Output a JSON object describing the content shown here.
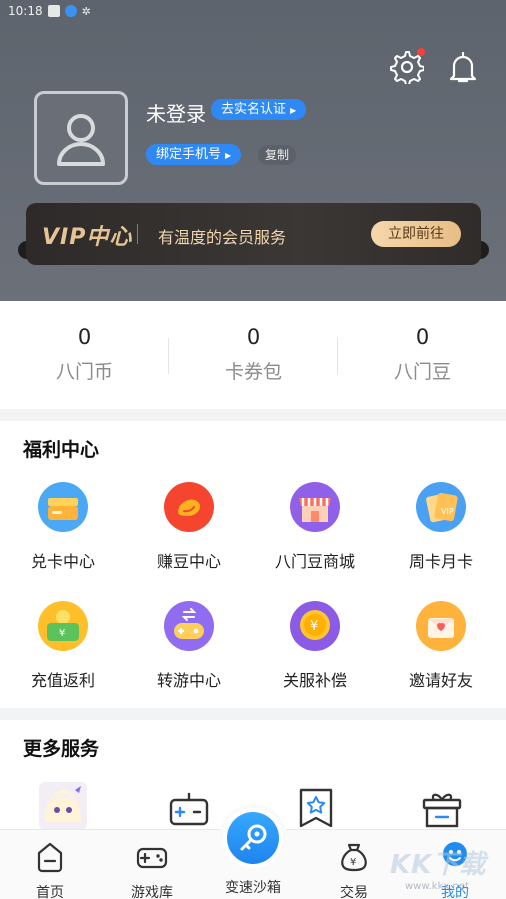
{
  "status_bar": {
    "time": "10:18"
  },
  "header": {
    "username": "未登录",
    "verify_label": "去实名认证",
    "bind_phone_label": "绑定手机号",
    "copy_label": "复制"
  },
  "vip": {
    "title": "VIP中心",
    "desc": "有温度的会员服务",
    "button": "立即前往"
  },
  "stats": [
    {
      "value": "0",
      "label": "八门币"
    },
    {
      "value": "0",
      "label": "卡券包"
    },
    {
      "value": "0",
      "label": "八门豆"
    }
  ],
  "welfare": {
    "title": "福利中心",
    "items": [
      {
        "label": "兑卡中心",
        "icon": "card-exchange-icon"
      },
      {
        "label": "赚豆中心",
        "icon": "earn-beans-icon"
      },
      {
        "label": "八门豆商城",
        "icon": "bean-mall-icon"
      },
      {
        "label": "周卡月卡",
        "icon": "weekly-monthly-card-icon"
      },
      {
        "label": "充值返利",
        "icon": "recharge-rebate-icon"
      },
      {
        "label": "转游中心",
        "icon": "game-transfer-icon"
      },
      {
        "label": "关服补偿",
        "icon": "server-close-compensation-icon"
      },
      {
        "label": "邀请好友",
        "icon": "invite-friends-icon"
      }
    ]
  },
  "more_services": {
    "title": "更多服务",
    "icons": [
      "anime-avatar-icon",
      "gamepad-box-icon",
      "bookmark-star-icon",
      "gift-box-icon"
    ]
  },
  "tabbar": {
    "items": [
      {
        "label": "首页",
        "icon": "home-icon"
      },
      {
        "label": "游戏库",
        "icon": "gamepad-icon"
      },
      {
        "label": "变速沙箱",
        "icon": "speed-sandbox-icon"
      },
      {
        "label": "交易",
        "icon": "money-bag-icon"
      },
      {
        "label": "我的",
        "icon": "profile-icon"
      }
    ],
    "active": "我的"
  },
  "colors": {
    "accent": "#1f8cf0",
    "header_bg": "#656a72",
    "vip_gold": "#e7c493",
    "red_dot": "#f5413e"
  },
  "watermark": {
    "text": "KK下载",
    "sub": "www.kkx.net"
  }
}
